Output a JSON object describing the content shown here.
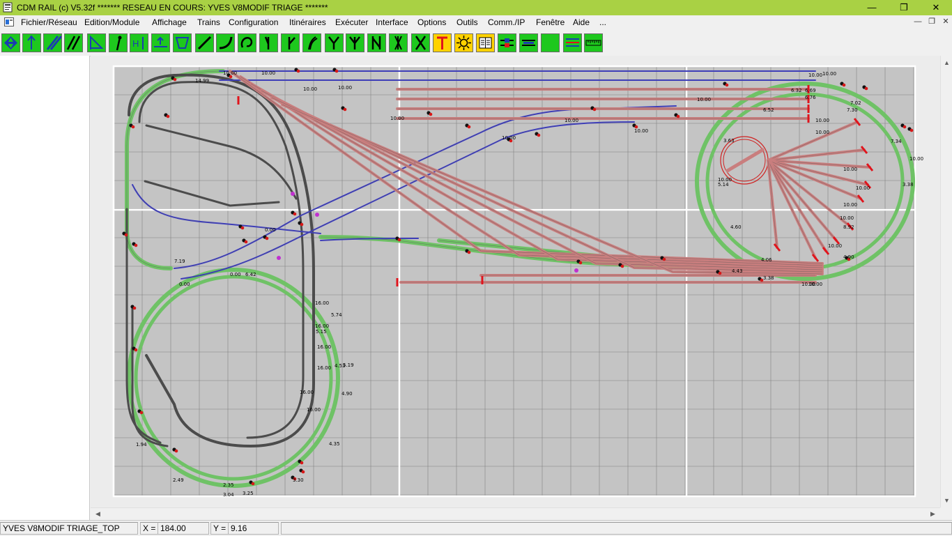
{
  "window": {
    "title": "CDM RAIL (c) V5.32f     ******* RESEAU EN COURS: YVES V8MODIF TRIAGE *******",
    "minimize": "—",
    "maximize": "❐",
    "close": "✕"
  },
  "menu": {
    "items": [
      "Fichier/Réseau",
      "Edition/Module",
      "Affichage",
      "Trains",
      "Configuration",
      "Itinéraires",
      "Exécuter",
      "Interface",
      "Options",
      "Outils",
      "Comm./IP",
      "Fenêtre",
      "Aide",
      "..."
    ],
    "mdi_minimize": "—",
    "mdi_restore": "❐",
    "mdi_close": "✕"
  },
  "toolbar": {
    "buttons": [
      {
        "icon": "zoom-diamond-icon",
        "color": "#1ec81e"
      },
      {
        "icon": "pointer-person-icon",
        "color": "#1ec81e"
      },
      {
        "icon": "pen-tool-icon",
        "color": "#1ec81e"
      },
      {
        "icon": "double-track-icon",
        "color": "#1ec81e"
      },
      {
        "icon": "angle-tool-icon",
        "color": "#1ec81e"
      },
      {
        "icon": "signal-pole-icon",
        "color": "#1ec81e"
      },
      {
        "icon": "height-tool-icon",
        "color": "#1ec81e"
      },
      {
        "icon": "platform-icon",
        "color": "#1ec81e"
      },
      {
        "icon": "turntable-icon",
        "color": "#1ec81e"
      },
      {
        "icon": "straight-track-icon",
        "color": "#1ec81e"
      },
      {
        "icon": "curve-track-icon",
        "color": "#1ec81e"
      },
      {
        "icon": "loop-track-icon",
        "color": "#1ec81e"
      },
      {
        "icon": "turnout-left-icon",
        "color": "#1ec81e"
      },
      {
        "icon": "turnout-right-icon",
        "color": "#1ec81e"
      },
      {
        "icon": "curved-turnout-icon",
        "color": "#1ec81e"
      },
      {
        "icon": "wye-turnout-icon",
        "color": "#1ec81e"
      },
      {
        "icon": "three-way-turnout-icon",
        "color": "#1ec81e"
      },
      {
        "icon": "double-slip-icon",
        "color": "#1ec81e"
      },
      {
        "icon": "crossing-icon",
        "color": "#1ec81e"
      },
      {
        "icon": "x-crossing-icon",
        "color": "#1ec81e"
      },
      {
        "icon": "track-end-icon",
        "color": "#ffd200"
      },
      {
        "icon": "sun-lighting-icon",
        "color": "#ffd200"
      },
      {
        "icon": "book-icon",
        "color": "#ffd200"
      },
      {
        "icon": "sensor-icon",
        "color": "#1ec81e"
      },
      {
        "icon": "block-icon",
        "color": "#1ec81e"
      },
      {
        "icon": "blank-green-icon",
        "color": "#1ec81e"
      },
      {
        "icon": "layer-lines-icon",
        "color": "#1ec81e"
      },
      {
        "icon": "ruler-icon",
        "color": "#1ec81e"
      }
    ]
  },
  "layout": {
    "labels": [
      "14.99",
      "10.00",
      "10.00",
      "10.00",
      "10.00",
      "10.00",
      "10.00",
      "10.00",
      "10.00",
      "10.00",
      "10.00",
      "10.00",
      "10.00",
      "10.00",
      "10.00",
      "6.32",
      "6.69",
      "6.76",
      "6.52",
      "7.02",
      "7.30",
      "7.34",
      "3.38",
      "10.00",
      "10.00",
      "10.00",
      "10.00",
      "10.00",
      "10.00",
      "10.00",
      "10.00",
      "3.63",
      "5.14",
      "4.60",
      "8.92",
      "4.06",
      "4.90",
      "3.38",
      "4.43",
      "16.00",
      "16.00",
      "16.00",
      "16.00",
      "16.00",
      "16.00",
      "1.94",
      "2.49",
      "2.35",
      "3.04",
      "3.25",
      "3.30",
      "4.35",
      "4.53",
      "4.90",
      "5.19",
      "5.74",
      "5.15",
      "6.42",
      "7.19",
      "0.00",
      "0.00",
      "0.00"
    ],
    "track_colors": {
      "main": "#6fc266",
      "yard": "#c97e7e",
      "branch": "#3a3acb",
      "grey": "#4a4a4a",
      "stop": "#e0141c"
    }
  },
  "status": {
    "layout_name": "YVES V8MODIF TRIAGE_TOP",
    "x_label": "X =",
    "x_value": "184.00",
    "y_label": "Y =",
    "y_value": "9.16"
  }
}
